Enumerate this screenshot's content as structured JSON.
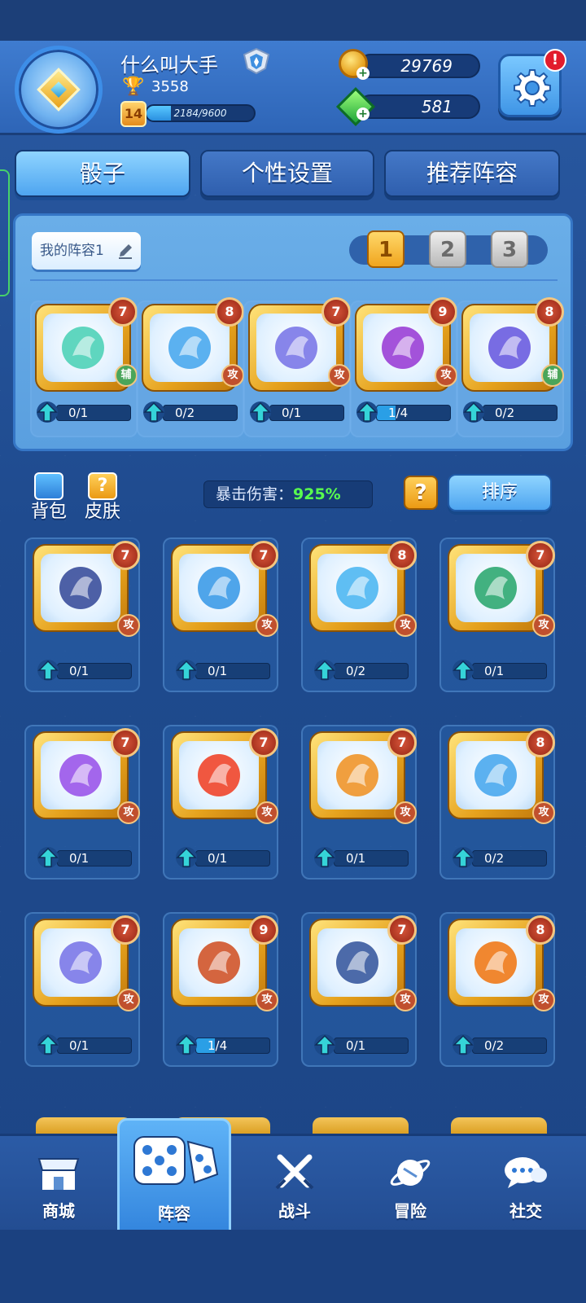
{
  "player": {
    "name": "什么叫大手",
    "trophies": "3558",
    "level": "14",
    "xp_text": "2184/9600",
    "xp_fraction": 0.2275
  },
  "currency": {
    "coins": "29769",
    "gems": "581"
  },
  "settings": {
    "alert": "!"
  },
  "tabs": [
    {
      "label": "骰子",
      "active": true
    },
    {
      "label": "个性设置",
      "active": false
    },
    {
      "label": "推荐阵容",
      "active": false
    }
  ],
  "deck": {
    "name": "我的阵容1",
    "slots": [
      "1",
      "2",
      "3"
    ],
    "active_slot": 0,
    "cards": [
      {
        "icon": "wind-swirl-dice-icon",
        "level": "7",
        "type": "辅",
        "progress": "0/1",
        "fill": 0,
        "support": true
      },
      {
        "icon": "ice-sword-dice-icon",
        "level": "8",
        "type": "攻",
        "progress": "0/2",
        "fill": 0,
        "support": false
      },
      {
        "icon": "lightning-sword-dice-icon",
        "level": "7",
        "type": "攻",
        "progress": "0/1",
        "fill": 0,
        "support": false
      },
      {
        "icon": "purple-claw-dice-icon",
        "level": "9",
        "type": "攻",
        "progress": "1/4",
        "fill": 0.25,
        "support": false
      },
      {
        "icon": "masked-mage-dice-icon",
        "level": "8",
        "type": "辅",
        "progress": "0/2",
        "fill": 0,
        "support": true
      }
    ]
  },
  "tools": {
    "bag": "背包",
    "skin": "皮肤"
  },
  "crit": {
    "label": "暴击伤害：",
    "value": "925%"
  },
  "help": "?",
  "sort_label": "排序",
  "collection": [
    {
      "icon": "moon-ghost-dice-icon",
      "level": "7",
      "type": "攻",
      "progress": "0/1",
      "fill": 0
    },
    {
      "icon": "wind-dragon-dice-icon",
      "level": "7",
      "type": "攻",
      "progress": "0/1",
      "fill": 0
    },
    {
      "icon": "lightning-dice-icon",
      "level": "8",
      "type": "攻",
      "progress": "0/2",
      "fill": 0
    },
    {
      "icon": "green-slime-dice-icon",
      "level": "7",
      "type": "攻",
      "progress": "0/1",
      "fill": 0
    },
    {
      "icon": "purple-ghost-dice-icon",
      "level": "7",
      "type": "攻",
      "progress": "0/1",
      "fill": 0
    },
    {
      "icon": "fire-dice-icon",
      "level": "7",
      "type": "攻",
      "progress": "0/1",
      "fill": 0
    },
    {
      "icon": "bull-dice-icon",
      "level": "7",
      "type": "攻",
      "progress": "0/1",
      "fill": 0
    },
    {
      "icon": "ice-sword-dice-icon",
      "level": "8",
      "type": "攻",
      "progress": "0/2",
      "fill": 0
    },
    {
      "icon": "lightning-sword-dice-icon",
      "level": "7",
      "type": "攻",
      "progress": "0/1",
      "fill": 0
    },
    {
      "icon": "war-banner-dice-icon",
      "level": "9",
      "type": "攻",
      "progress": "1/4",
      "fill": 0.25
    },
    {
      "icon": "volcano-dice-icon",
      "level": "7",
      "type": "攻",
      "progress": "0/1",
      "fill": 0
    },
    {
      "icon": "pumpkin-witch-dice-icon",
      "level": "8",
      "type": "攻",
      "progress": "0/2",
      "fill": 0
    }
  ],
  "nav": [
    {
      "label": "商城",
      "icon": "shop-icon",
      "active": false
    },
    {
      "label": "阵容",
      "icon": "dice-icon",
      "active": true
    },
    {
      "label": "战斗",
      "icon": "crossed-swords-icon",
      "active": false
    },
    {
      "label": "冒险",
      "icon": "planet-icon",
      "active": false
    },
    {
      "label": "社交",
      "icon": "chat-icon",
      "active": false
    }
  ],
  "colors": {
    "accent": "#4ea5f0",
    "gold": "#f0a51e",
    "crit_green": "#59ff4e",
    "attack_badge": "#c0502e",
    "support_badge": "#4aa55a"
  }
}
